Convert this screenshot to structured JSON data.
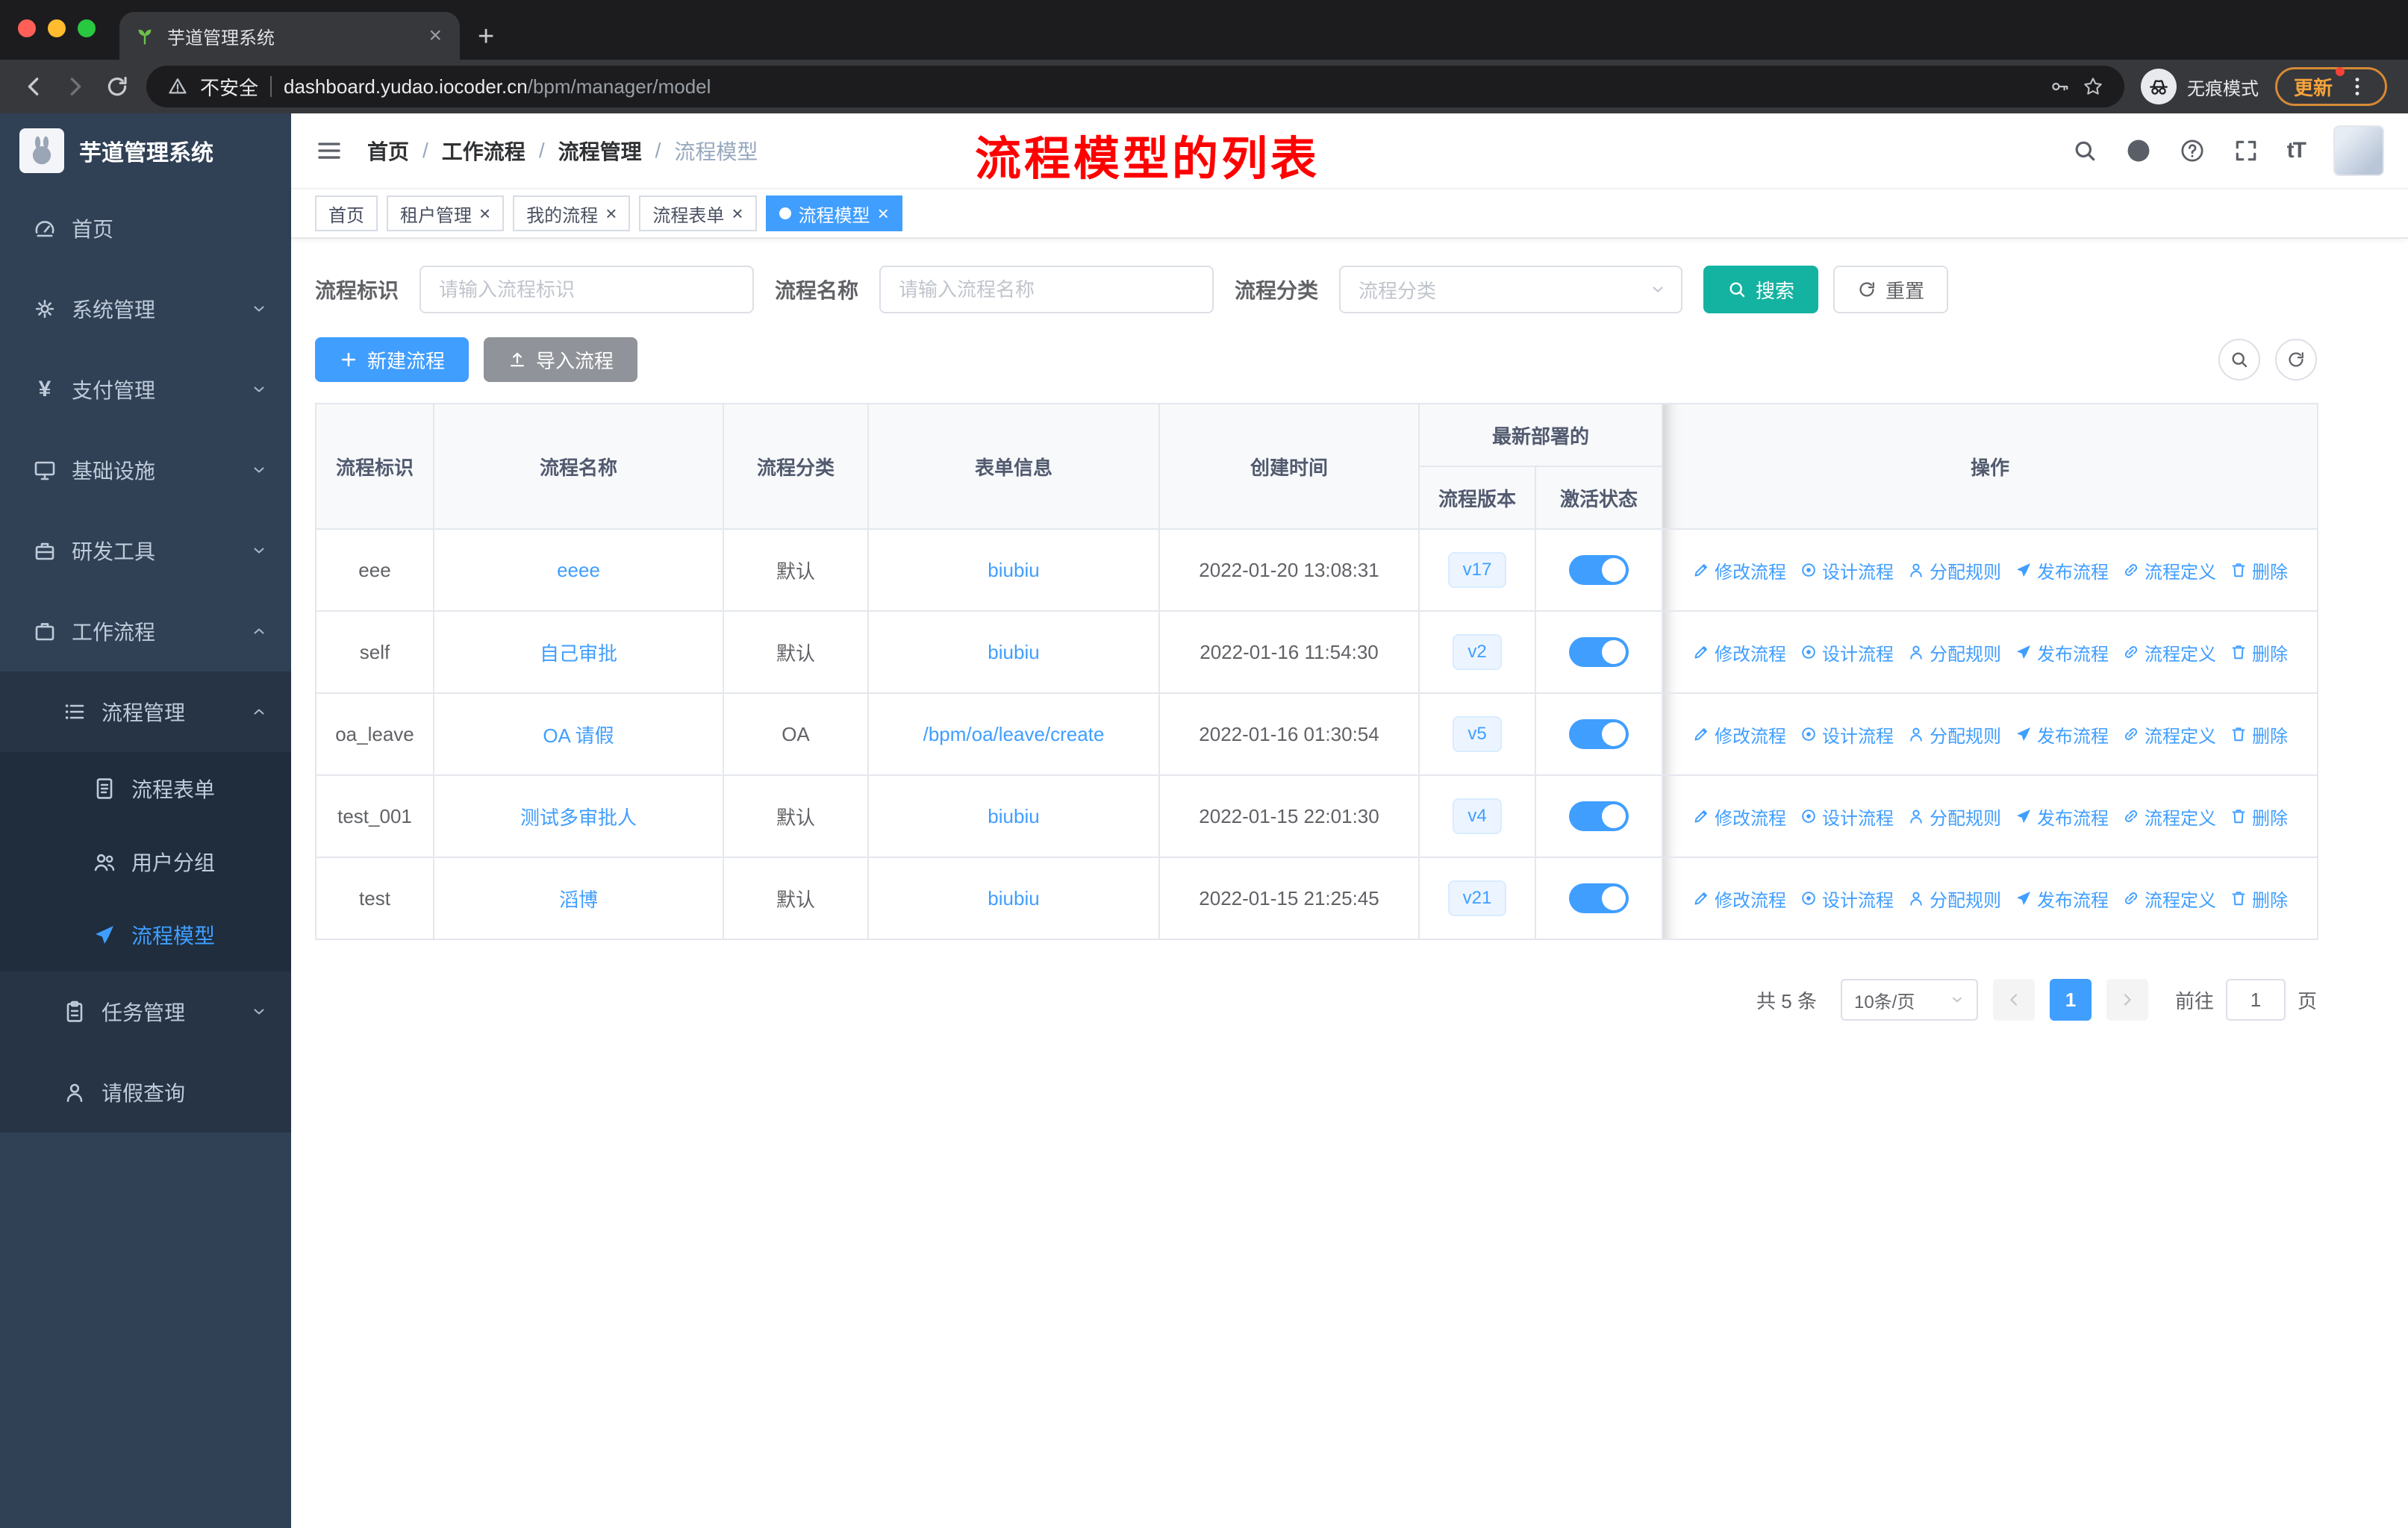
{
  "browser": {
    "tab_title": "芋道管理系统",
    "url_host": "dashboard.yudao.iocoder.cn",
    "url_path": "/bpm/manager/model",
    "security_label": "不安全",
    "incognito_label": "无痕模式",
    "update_label": "更新"
  },
  "sidebar": {
    "logo_text": "芋道管理系统",
    "items": {
      "home": "首页",
      "system": "系统管理",
      "payment": "支付管理",
      "infra": "基础设施",
      "dev_tools": "研发工具",
      "workflow": "工作流程",
      "process_mgmt": "流程管理",
      "process_form": "流程表单",
      "user_group": "用户分组",
      "process_model": "流程模型",
      "task_mgmt": "任务管理",
      "leave_query": "请假查询"
    }
  },
  "header": {
    "breadcrumb": [
      "首页",
      "工作流程",
      "流程管理",
      "流程模型"
    ],
    "annotation": "流程模型的列表"
  },
  "tags": {
    "home": "首页",
    "tenant": "租户管理",
    "my_process": "我的流程",
    "process_form": "流程表单",
    "process_model": "流程模型"
  },
  "filters": {
    "id_label": "流程标识",
    "id_placeholder": "请输入流程标识",
    "name_label": "流程名称",
    "name_placeholder": "请输入流程名称",
    "category_label": "流程分类",
    "category_placeholder": "流程分类",
    "search_label": "搜索",
    "reset_label": "重置"
  },
  "toolbar": {
    "create_label": "新建流程",
    "import_label": "导入流程"
  },
  "table": {
    "col_id": "流程标识",
    "col_name": "流程名称",
    "col_category": "流程分类",
    "col_form": "表单信息",
    "col_created": "创建时间",
    "col_group": "最新部署的",
    "col_version": "流程版本",
    "col_status": "激活状态",
    "col_ops": "操作",
    "ops": [
      "修改流程",
      "设计流程",
      "分配规则",
      "发布流程",
      "流程定义",
      "删除"
    ],
    "rows": [
      {
        "id": "eee",
        "name": "eeee",
        "category": "默认",
        "form": "biubiu",
        "created": "2022-01-20 13:08:31",
        "version": "v17"
      },
      {
        "id": "self",
        "name": "自己审批",
        "category": "默认",
        "form": "biubiu",
        "created": "2022-01-16 11:54:30",
        "version": "v2"
      },
      {
        "id": "oa_leave",
        "name": "OA 请假",
        "category": "OA",
        "form": "/bpm/oa/leave/create",
        "created": "2022-01-16 01:30:54",
        "version": "v5"
      },
      {
        "id": "test_001",
        "name": "测试多审批人",
        "category": "默认",
        "form": "biubiu",
        "created": "2022-01-15 22:01:30",
        "version": "v4"
      },
      {
        "id": "test",
        "name": "滔博",
        "category": "默认",
        "form": "biubiu",
        "created": "2022-01-15 21:25:45",
        "version": "v21"
      }
    ]
  },
  "pagination": {
    "total": "共 5 条",
    "page_size": "10条/页",
    "current_page": "1",
    "goto_label": "前往",
    "goto_value": "1",
    "page_unit": "页"
  },
  "colors": {
    "primary_blue": "#409eff",
    "search_button_teal": "#14b3a1",
    "info_gray": "#909399",
    "annotation_red": "#ff0000",
    "sidebar_bg": "#304156",
    "toggle_on": "#409eff",
    "active_tag": "#409eff"
  }
}
